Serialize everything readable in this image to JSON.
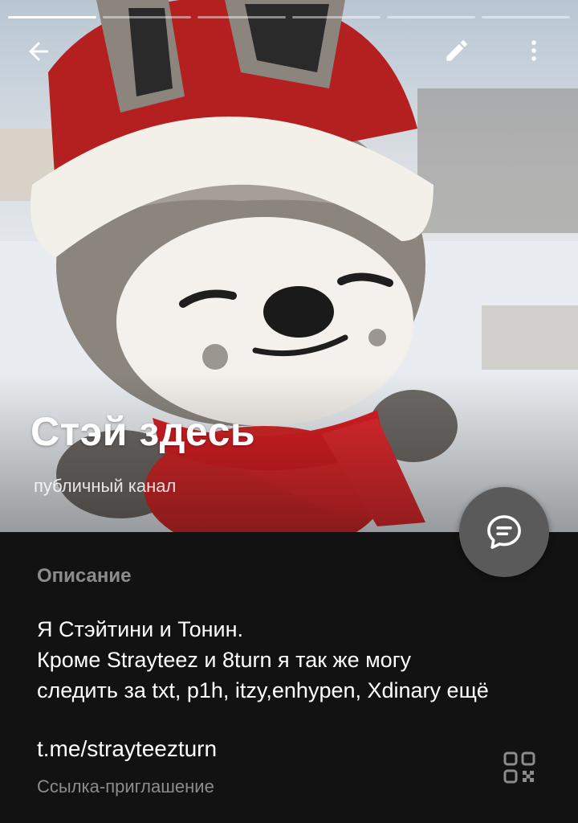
{
  "header": {
    "story_segments": 6,
    "active_segment": 0
  },
  "channel": {
    "title": "Стэй здесь",
    "type_label": "публичный канал"
  },
  "description": {
    "heading": "Описание",
    "lines": [
      "Я Стэйтини и Тонин.",
      "Кроме Strayteez и 8turn я так же могу",
      "следить за txt, p1h, itzy,enhypen, Xdinary ещё"
    ]
  },
  "invite": {
    "link": "t.me/strayteezturn",
    "caption": "Ссылка-приглашение"
  },
  "icons": {
    "back": "arrow-left-icon",
    "edit": "pencil-icon",
    "more": "more-vertical-icon",
    "chat": "chat-bubble-icon",
    "qr": "qr-code-icon"
  },
  "colors": {
    "background": "#121212",
    "fab": "#5a5a5a",
    "muted_text": "#8c8c8c"
  }
}
